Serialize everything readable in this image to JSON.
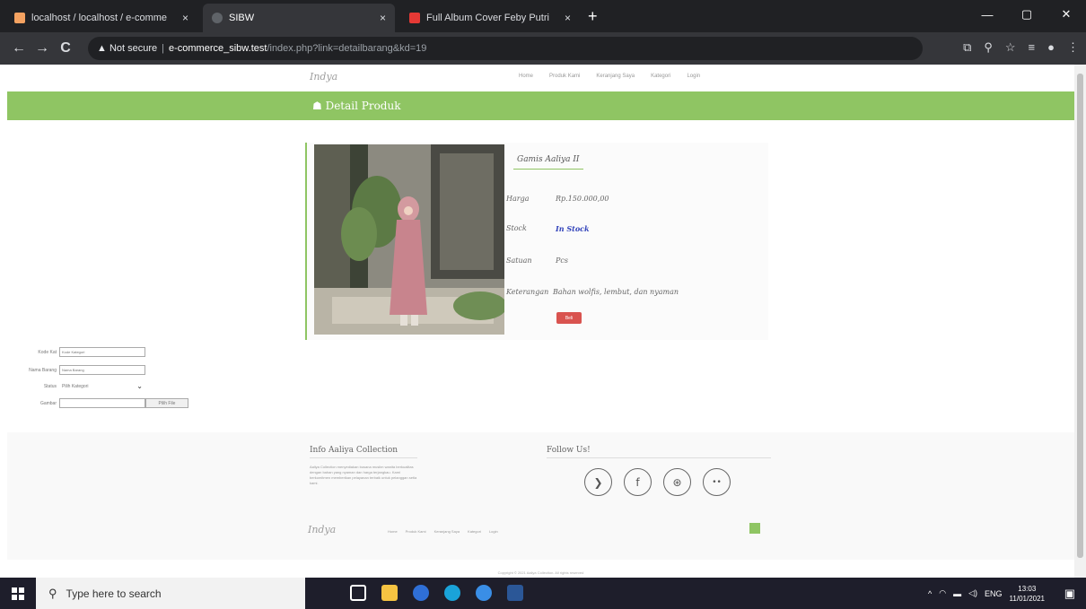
{
  "browser": {
    "tabs": [
      {
        "title": "localhost / localhost / e-comme",
        "close": "×"
      },
      {
        "title": "SIBW",
        "close": "×"
      },
      {
        "title": "Full Album Cover Feby Putri",
        "close": "×"
      }
    ],
    "new_tab": "+",
    "window_controls": {
      "minimize": "—",
      "maximize": "▢",
      "close": "✕"
    },
    "nav": {
      "back": "←",
      "forward": "→",
      "reload": "C"
    },
    "address": {
      "warning": "▲ Not secure",
      "host": "e-commerce_sibw.test",
      "path": "/index.php?link=detailbarang&kd=19"
    }
  },
  "site": {
    "logo": "Indya",
    "nav": [
      "Home",
      "Produk Kami",
      "Keranjang Saya",
      "Kategori",
      "Login"
    ],
    "banner_title": "☗ Detail Produk"
  },
  "product": {
    "name": "Gamis Aaliya II",
    "rows": [
      {
        "key": "Harga",
        "value": "Rp.150.000,00"
      },
      {
        "key": "Stock",
        "value": "In Stock"
      },
      {
        "key": "Satuan",
        "value": "Pcs"
      },
      {
        "key": "Keterangan",
        "value": "Bahan wolfis, lembut, dan nyaman"
      }
    ],
    "buy_label": "Beli"
  },
  "side_form": {
    "rows": [
      {
        "label": "Kode Kat",
        "placeholder": "Kode Kategori"
      },
      {
        "label": "Nama Barang",
        "placeholder": "Nama Barang"
      },
      {
        "label": "Status",
        "select": "Pilih Kategori"
      },
      {
        "label": "Gambar",
        "button": "Pilih File"
      }
    ]
  },
  "footer": {
    "about_title": "Info Aaliya Collection",
    "about_text": "Aaliya Collection menyediakan busana muslim wanita berkualitas dengan bahan yang nyaman dan harga terjangkau. Kami berkomitmen memberikan pelayanan terbaik untuk pelanggan setia kami.",
    "follow_title": "Follow Us!",
    "socials": [
      "twitter-icon",
      "facebook-icon",
      "pinterest-icon",
      "flickr-icon"
    ],
    "social_glyphs": [
      "❯",
      "f",
      "⊛",
      "••"
    ],
    "logo": "Indya",
    "links": [
      "Home",
      "Produk Kami",
      "Keranjang Saya",
      "Kategori",
      "Login"
    ],
    "copyright": "Copyright © 2021 Aaliya Collection. All rights reserved"
  },
  "taskbar": {
    "search_placeholder": "Type here to search",
    "tray_lang": "ENG",
    "time": "13:03",
    "date": "11/01/2021"
  },
  "colors": {
    "accent_green": "#8fc563",
    "buy_red": "#d9534f"
  }
}
